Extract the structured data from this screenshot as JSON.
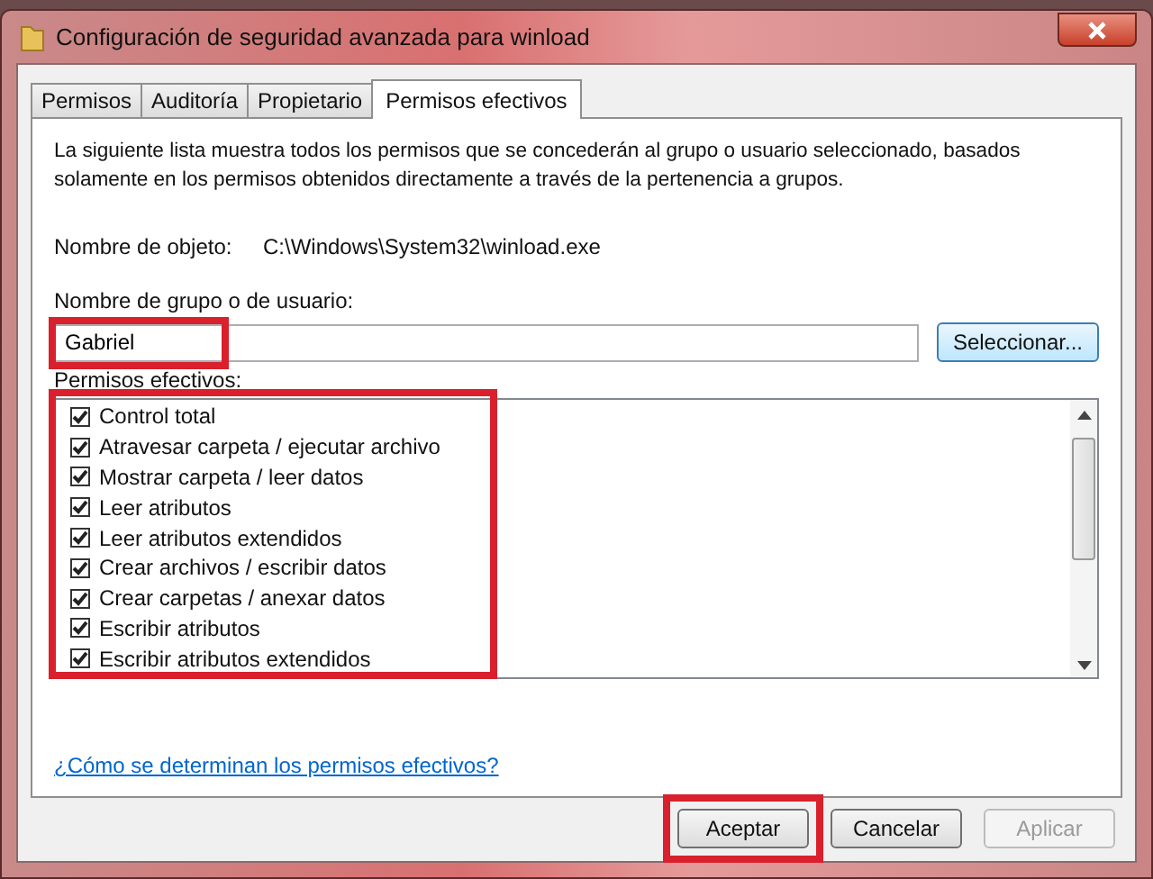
{
  "window": {
    "title": "Configuración de seguridad avanzada para winload"
  },
  "tabs": [
    {
      "label": "Permisos",
      "selected": false
    },
    {
      "label": "Auditoría",
      "selected": false
    },
    {
      "label": "Propietario",
      "selected": false
    },
    {
      "label": "Permisos efectivos",
      "selected": true
    }
  ],
  "description": "La siguiente lista muestra todos los permisos que se concederán al grupo o usuario seleccionado, basados solamente en los permisos obtenidos directamente a través de la pertenencia a grupos.",
  "object": {
    "label": "Nombre de objeto:",
    "value": "C:\\Windows\\System32\\winload.exe"
  },
  "user": {
    "label": "Nombre de grupo o de usuario:",
    "value": "Gabriel",
    "highlighted": true,
    "button": "Seleccionar..."
  },
  "permissions": {
    "label": "Permisos efectivos:",
    "highlighted": true,
    "items": [
      {
        "label": "Control total",
        "checked": true
      },
      {
        "label": "Atravesar carpeta / ejecutar archivo",
        "checked": true
      },
      {
        "label": "Mostrar carpeta / leer datos",
        "checked": true
      },
      {
        "label": "Leer atributos",
        "checked": true
      },
      {
        "label": "Leer atributos extendidos",
        "checked": true
      },
      {
        "label": "Crear archivos / escribir datos",
        "checked": true
      },
      {
        "label": "Crear carpetas / anexar datos",
        "checked": true
      },
      {
        "label": "Escribir atributos",
        "checked": true
      },
      {
        "label": "Escribir atributos extendidos",
        "checked": true
      }
    ]
  },
  "help_link": "¿Cómo se determinan los permisos efectivos?",
  "buttons": [
    {
      "label": "Aceptar",
      "disabled": false,
      "highlighted": true
    },
    {
      "label": "Cancelar",
      "disabled": false,
      "highlighted": false
    },
    {
      "label": "Aplicar",
      "disabled": true,
      "highlighted": false
    }
  ]
}
